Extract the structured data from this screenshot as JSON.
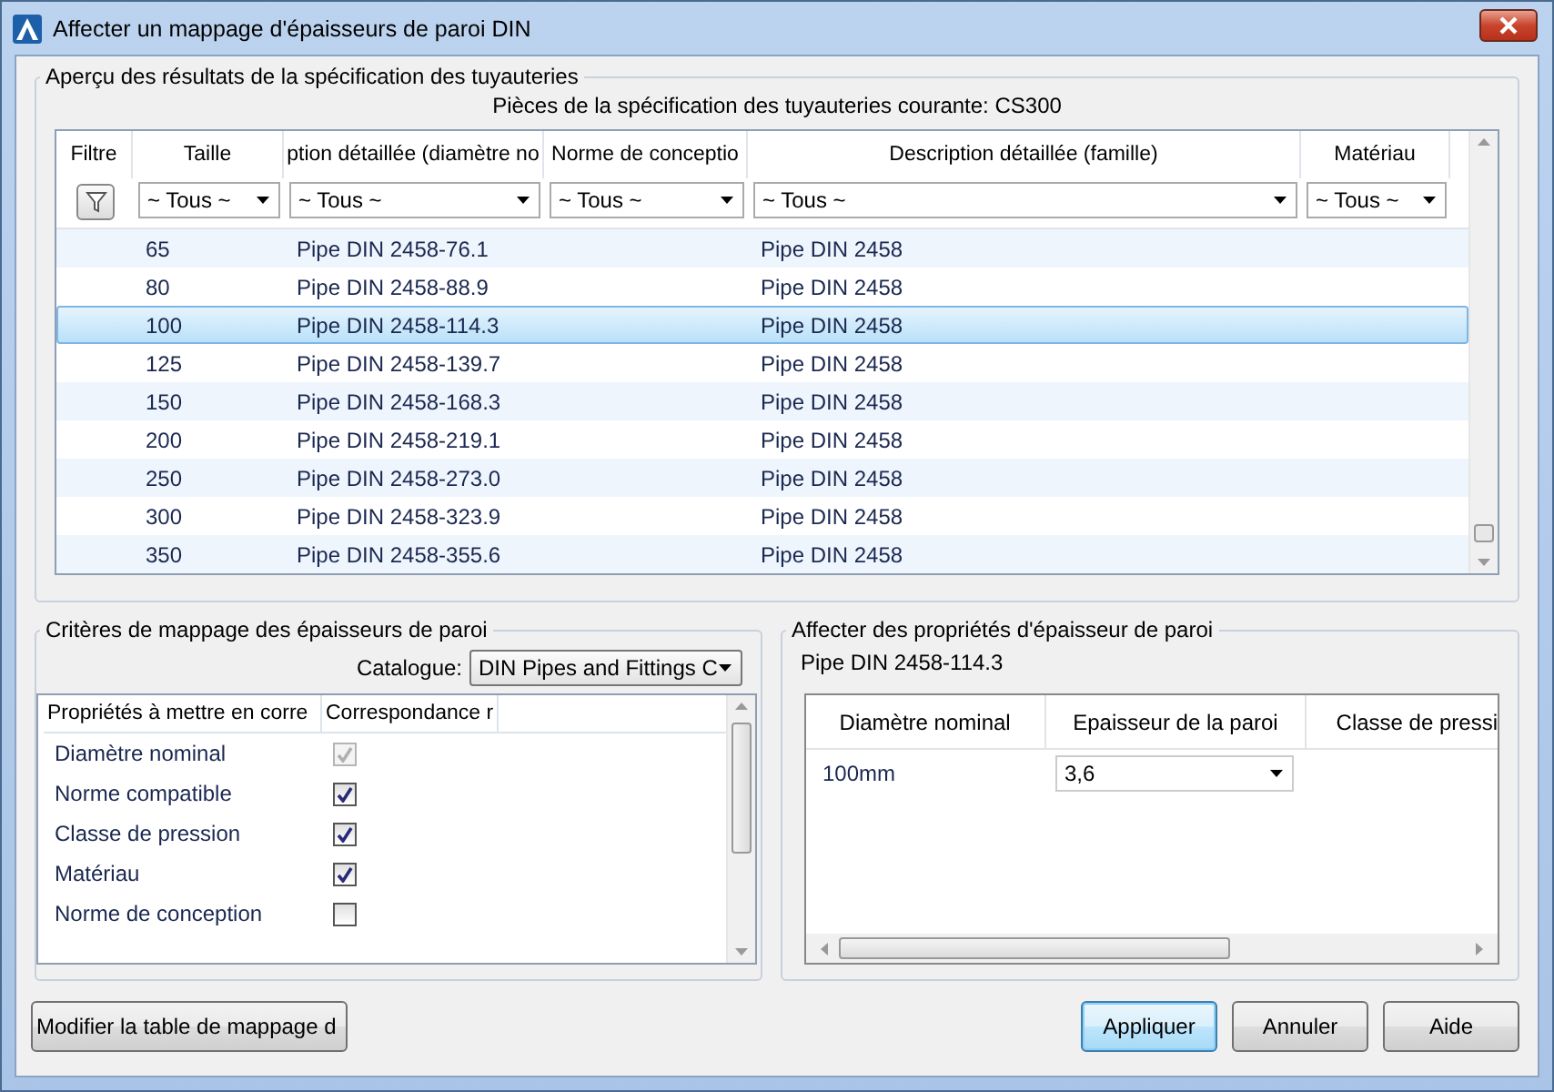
{
  "window": {
    "title": "Affecter un mappage d'épaisseurs de paroi DIN"
  },
  "preview": {
    "legend": "Aperçu des résultats de la spécification des tuyauteries",
    "subtitle": "Pièces de la spécification des tuyauteries courante: CS300",
    "columns": [
      {
        "label": "Filtre"
      },
      {
        "label": "Taille",
        "filter": "~ Tous ~"
      },
      {
        "label": "ption détaillée (diamètre no",
        "filter": "~ Tous ~"
      },
      {
        "label": "Norme de conceptio",
        "filter": "~ Tous ~"
      },
      {
        "label": "Description détaillée (famille)",
        "filter": "~ Tous ~"
      },
      {
        "label": "Matériau",
        "filter": "~ Tous ~"
      }
    ],
    "rows": [
      {
        "taille": "65",
        "description": "Pipe DIN 2458-76.1",
        "famille": "Pipe DIN 2458",
        "selected": false
      },
      {
        "taille": "80",
        "description": "Pipe DIN 2458-88.9",
        "famille": "Pipe DIN 2458",
        "selected": false
      },
      {
        "taille": "100",
        "description": "Pipe DIN 2458-114.3",
        "famille": "Pipe DIN 2458",
        "selected": true
      },
      {
        "taille": "125",
        "description": "Pipe DIN 2458-139.7",
        "famille": "Pipe DIN 2458",
        "selected": false
      },
      {
        "taille": "150",
        "description": "Pipe DIN 2458-168.3",
        "famille": "Pipe DIN 2458",
        "selected": false
      },
      {
        "taille": "200",
        "description": "Pipe DIN 2458-219.1",
        "famille": "Pipe DIN 2458",
        "selected": false
      },
      {
        "taille": "250",
        "description": "Pipe DIN 2458-273.0",
        "famille": "Pipe DIN 2458",
        "selected": false
      },
      {
        "taille": "300",
        "description": "Pipe DIN 2458-323.9",
        "famille": "Pipe DIN 2458",
        "selected": false
      },
      {
        "taille": "350",
        "description": "Pipe DIN 2458-355.6",
        "famille": "Pipe DIN 2458",
        "selected": false
      }
    ]
  },
  "criteria": {
    "legend": "Critères de mappage des épaisseurs de paroi",
    "catalogue_label": "Catalogue:",
    "catalogue_value": "DIN Pipes and Fittings C",
    "columns": [
      "Propriétés à mettre en corre",
      "Correspondance r"
    ],
    "rows": [
      {
        "label": "Diamètre nominal",
        "checked": true,
        "disabled": true
      },
      {
        "label": "Norme compatible",
        "checked": true,
        "disabled": false
      },
      {
        "label": "Classe de pression",
        "checked": true,
        "disabled": false
      },
      {
        "label": "Matériau",
        "checked": true,
        "disabled": false
      },
      {
        "label": "Norme de conception",
        "checked": false,
        "disabled": false
      }
    ]
  },
  "assign": {
    "legend": "Affecter des propriétés d'épaisseur de paroi",
    "part": "Pipe DIN 2458-114.3",
    "columns": [
      "Diamètre nominal",
      "Epaisseur de la paroi",
      "Classe de pressi"
    ],
    "rows": [
      {
        "diametre": "100mm",
        "epaisseur": "3,6"
      }
    ]
  },
  "buttons": [
    {
      "label": "Modifier la table de mappage d",
      "kind": "left",
      "focused": false
    },
    {
      "label": "Appliquer",
      "kind": "right",
      "focused": true
    },
    {
      "label": "Annuler",
      "kind": "right",
      "focused": false
    },
    {
      "label": "Aide",
      "kind": "right",
      "focused": false
    }
  ]
}
